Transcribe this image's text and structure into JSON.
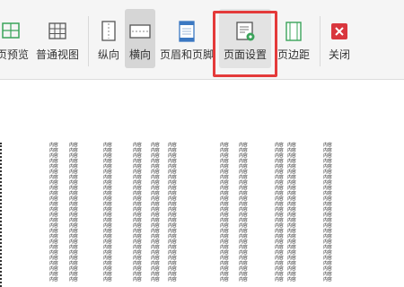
{
  "toolbar": {
    "buttons": [
      {
        "id": "print-preview",
        "label": "页预览",
        "icon": "page-preview-icon"
      },
      {
        "id": "normal-view",
        "label": "普通视图",
        "icon": "grid-icon"
      },
      {
        "id": "portrait",
        "label": "纵向",
        "icon": "portrait-page-icon"
      },
      {
        "id": "landscape",
        "label": "横向",
        "icon": "landscape-page-icon"
      },
      {
        "id": "header-footer",
        "label": "页眉和页脚",
        "icon": "header-footer-icon"
      },
      {
        "id": "page-setup",
        "label": "页面设置",
        "icon": "page-setup-icon"
      },
      {
        "id": "page-margins",
        "label": "页边距",
        "icon": "margins-icon"
      },
      {
        "id": "close",
        "label": "关闭",
        "icon": "close-icon"
      }
    ],
    "accent_close": "#d9363e",
    "highlight_color": "#e43a3a"
  },
  "document": {
    "cell_text": "内容"
  }
}
